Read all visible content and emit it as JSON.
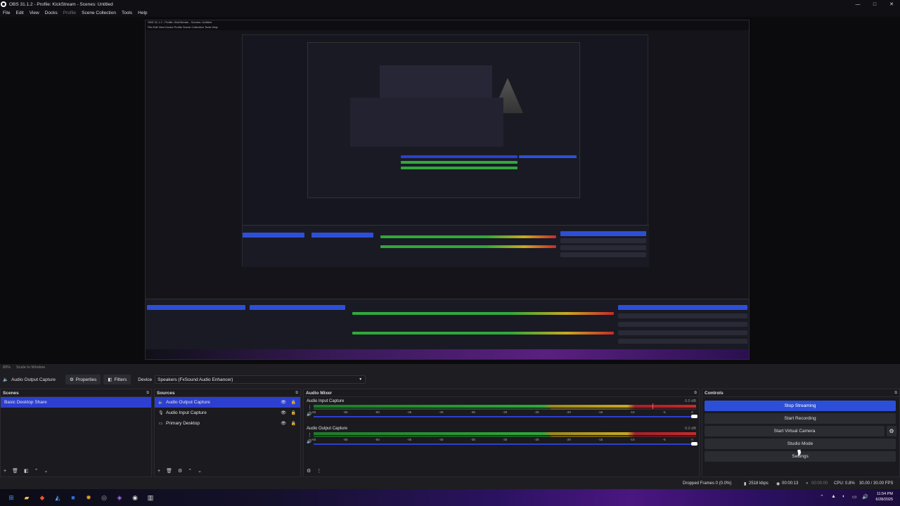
{
  "app": {
    "title": "OBS 31.1.2 - Profile: KickStream - Scenes: Untitled",
    "window_controls": [
      "—",
      "□",
      "✕"
    ]
  },
  "menu": {
    "items": [
      "File",
      "Edit",
      "View",
      "Docks",
      "Profile",
      "Scene Collection",
      "Tools",
      "Help"
    ]
  },
  "preview": {
    "nested_title": "OBS 31.1.2 - Profile: KickStream - Scenes: Untitled",
    "nested_menu": "File  Edit  View  Docks  Profile  Scene Collection  Tools  Help"
  },
  "zoom": {
    "percent": "89%",
    "scale_label": "Scale to Window"
  },
  "source_toolbar": {
    "source_name": "Audio Output Capture",
    "properties_label": "Properties",
    "filters_label": "Filters",
    "device_label": "Device",
    "device_value": "Speakers (FxSound Audio Enhancer)"
  },
  "scenes": {
    "title": "Scenes",
    "items": [
      "Basic Desktop Share"
    ]
  },
  "sources": {
    "title": "Sources",
    "items": [
      {
        "label": "Audio Output Capture",
        "icon": "speaker-icon"
      },
      {
        "label": "Audio Input Capture",
        "icon": "microphone-icon"
      },
      {
        "label": "Primary Desktop",
        "icon": "monitor-icon"
      }
    ]
  },
  "mixer": {
    "title": "Audio Mixer",
    "channels": [
      {
        "name": "Audio Input Capture",
        "db": "0.0 dB"
      },
      {
        "name": "Audio Output Capture",
        "db": "0.0 dB"
      }
    ],
    "ticks": [
      "-60",
      "-55",
      "-50",
      "-45",
      "-40",
      "-35",
      "-30",
      "-25",
      "-20",
      "-15",
      "-10",
      "-5",
      "0"
    ]
  },
  "controls": {
    "title": "Controls",
    "stop_streaming": "Stop Streaming",
    "start_recording": "Start Recording",
    "start_virtual_camera": "Start Virtual Camera",
    "studio_mode": "Studio Mode",
    "settings": "Settings"
  },
  "status": {
    "dropped_frames": "Dropped Frames 0 (0.0%)",
    "bitrate": "2518 kbps",
    "stream_time": "00:00:13",
    "record_time": "00:00:00",
    "cpu": "CPU: 0.8%",
    "fps": "30.00 / 30.00 FPS"
  },
  "taskbar": {
    "time": "11:54 PM",
    "date": "6/28/2025"
  },
  "colors": {
    "accent": "#2d4fd8",
    "background": "#1e1e22",
    "meter_green": "#2fa83a",
    "meter_yellow": "#c9a822",
    "meter_red": "#c82a2a"
  }
}
